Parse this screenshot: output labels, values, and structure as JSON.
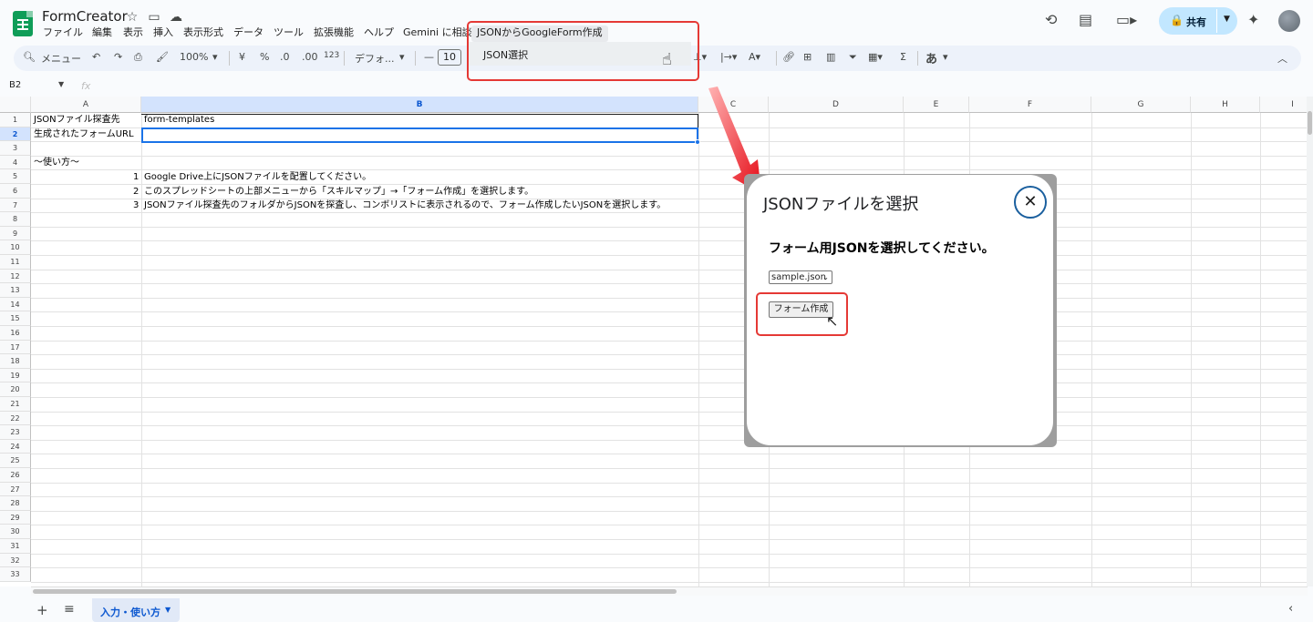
{
  "app": {
    "doc_title": "FormCreator",
    "menus": [
      "ファイル",
      "編集",
      "表示",
      "挿入",
      "表示形式",
      "データ",
      "ツール",
      "拡張機能",
      "ヘルプ",
      "Gemini に相談",
      "JSONからGoogleForm作成"
    ],
    "share_label": "共有"
  },
  "toolbar": {
    "search_label": "メニュー",
    "zoom": "100%",
    "currency": "¥",
    "percent": "%",
    "dec_decrease": ".0",
    "dec_increase": ".00",
    "number_format": "123",
    "font": "デフォ...",
    "font_size": "10",
    "input_tool": "あ"
  },
  "dropdown": {
    "item": "JSON選択"
  },
  "formula_bar": {
    "cell_ref": "B2",
    "fx": "fx"
  },
  "columns": [
    "A",
    "B",
    "C",
    "D",
    "E",
    "F",
    "G",
    "H",
    "I"
  ],
  "rows": [
    "1",
    "2",
    "3",
    "4",
    "5",
    "6",
    "7",
    "8",
    "9",
    "10",
    "11",
    "12",
    "13",
    "14",
    "15",
    "16",
    "17",
    "18",
    "19",
    "20",
    "21",
    "22",
    "23",
    "24",
    "25",
    "26",
    "27",
    "28",
    "29",
    "30",
    "31",
    "32",
    "33"
  ],
  "cells": {
    "a1": "JSONファイル探査先",
    "b1": "form-templates",
    "a2": "生成されたフォームURL",
    "a4": "〜使い方〜",
    "a5": "1",
    "b5": "Google Drive上にJSONファイルを配置してください。",
    "a6": "2",
    "b6": "このスプレッドシートの上部メニューから「スキルマップ」→「フォーム作成」を選択します。",
    "a7": "3",
    "b7": "JSONファイル探査先のフォルダからJSONを探査し、コンボリストに表示されるので、フォーム作成したいJSONを選択します。"
  },
  "sheet_tab": {
    "label": "入力・使い方"
  },
  "dialog": {
    "title": "JSONファイルを選択",
    "prompt": "フォーム用JSONを選択してください。",
    "selected_file": "sample.json",
    "create_button": "フォーム作成"
  },
  "colors": {
    "highlight": "#e53935",
    "accent_blue": "#1a73e8",
    "share_bg": "#c2e7ff"
  }
}
